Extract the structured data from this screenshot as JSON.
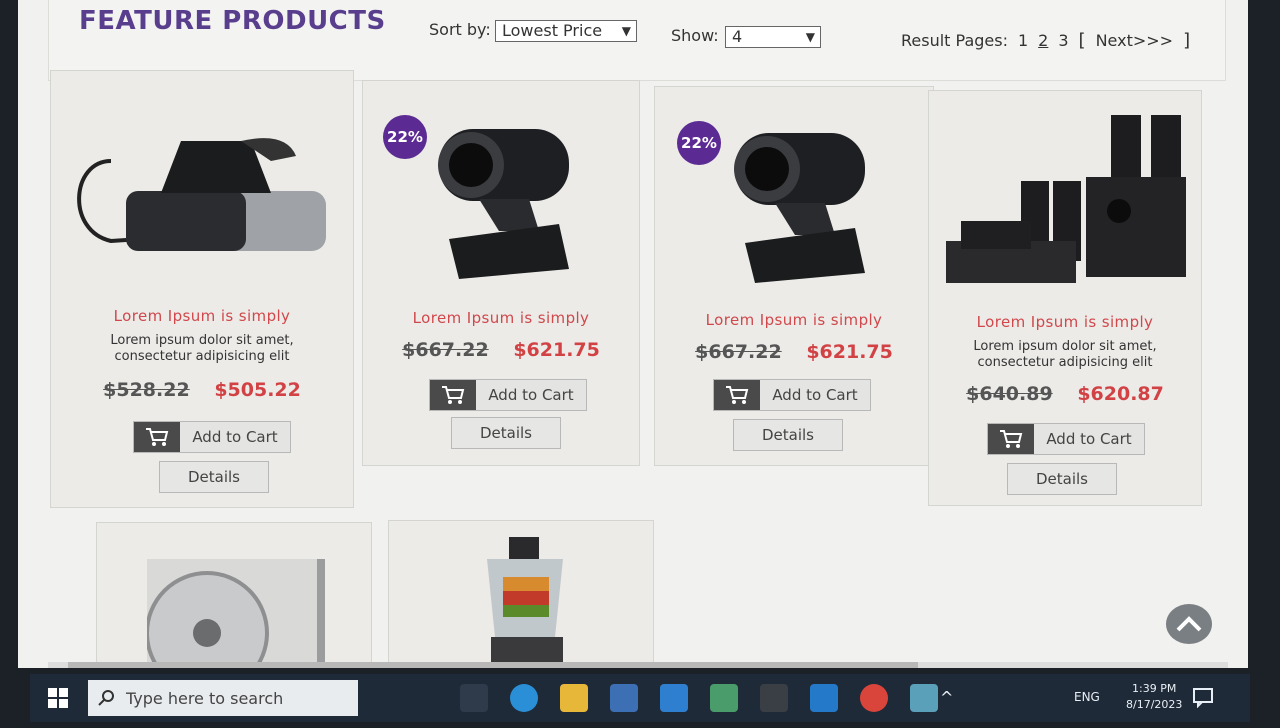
{
  "header": {
    "title": "FEATURE PRODUCTS",
    "sort_label": "Sort by:",
    "sort_value": "Lowest Price",
    "show_label": "Show:",
    "show_value": "4",
    "result_label": "Result Pages:",
    "pages": [
      "1",
      "2",
      "3"
    ],
    "current_page": "2",
    "next_label": "Next>>>",
    "bracket_open": "[",
    "bracket_close": "]"
  },
  "products": [
    {
      "title": "Lorem Ipsum is simply",
      "desc": "Lorem ipsum dolor sit amet, consectetur adipisicing elit",
      "old_price": "$528.22",
      "new_price": "$505.22",
      "badge": "",
      "cart_label": "Add to Cart",
      "details_label": "Details",
      "image": "steam-iron"
    },
    {
      "title": "Lorem Ipsum is simply",
      "desc": "",
      "old_price": "$667.22",
      "new_price": "$621.75",
      "badge": "22%",
      "cart_label": "Add to Cart",
      "details_label": "Details",
      "image": "webcam"
    },
    {
      "title": "Lorem Ipsum is simply",
      "desc": "",
      "old_price": "$667.22",
      "new_price": "$621.75",
      "badge": "22%",
      "cart_label": "Add to Cart",
      "details_label": "Details",
      "image": "webcam"
    },
    {
      "title": "Lorem Ipsum is simply",
      "desc": "Lorem ipsum dolor sit amet, consectetur adipisicing elit",
      "old_price": "$640.89",
      "new_price": "$620.87",
      "badge": "",
      "cart_label": "Add to Cart",
      "details_label": "Details",
      "image": "speakers"
    }
  ],
  "lower_products": [
    {
      "image": "fan"
    },
    {
      "image": "blender"
    }
  ],
  "taskbar": {
    "search_placeholder": "Type here to search",
    "lang": "ENG",
    "time": "1:39 PM",
    "date": "8/17/2023"
  },
  "colors": {
    "accent": "#5a3e8e",
    "price_new": "#d24245",
    "title_red": "#d0484c",
    "badge": "#5b2a93"
  }
}
